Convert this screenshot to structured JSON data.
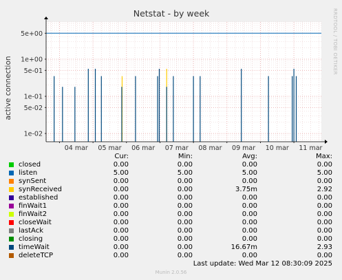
{
  "chart_data": {
    "type": "line",
    "title": "Netstat - by week",
    "ylabel": "active connection",
    "yscale": "log",
    "ylim": [
      0.006,
      10
    ],
    "yticks": [
      0.01,
      0.05,
      0.1,
      0.5,
      1,
      5
    ],
    "ytick_labels": [
      "1e-02",
      "5e-02",
      "1e-01",
      "5e-01",
      "1e+00",
      "5e+00"
    ],
    "xticks": [
      "04 mar",
      "05 mar",
      "06 mar",
      "07 mar",
      "08 mar",
      "09 mar",
      "10 mar",
      "11 mar"
    ],
    "xlim_days": [
      3.6,
      11.82
    ],
    "grid": true,
    "watermark": "RRDTOOL / TOBI OETIKER",
    "series": [
      {
        "name": "closed",
        "color": "#00cc00",
        "values": []
      },
      {
        "name": "listen",
        "color": "#0066b3",
        "constant": 5.0,
        "values": []
      },
      {
        "name": "synSent",
        "color": "#ff8000",
        "values": []
      },
      {
        "name": "synReceived",
        "color": "#ffcc00",
        "spikes": [
          [
            5.87,
            0.35
          ],
          [
            7.2,
            0.55
          ]
        ]
      },
      {
        "name": "established",
        "color": "#330099",
        "values": []
      },
      {
        "name": "finWait1",
        "color": "#990099",
        "values": []
      },
      {
        "name": "finWait2",
        "color": "#ccff00",
        "values": []
      },
      {
        "name": "closeWait",
        "color": "#ff0000",
        "values": []
      },
      {
        "name": "lastAck",
        "color": "#808080",
        "values": []
      },
      {
        "name": "closing",
        "color": "#008f00",
        "values": []
      },
      {
        "name": "timeWait",
        "color": "#00487d",
        "spikes": [
          [
            3.84,
            0.35
          ],
          [
            4.09,
            0.18
          ],
          [
            4.46,
            0.18
          ],
          [
            4.86,
            0.55
          ],
          [
            5.07,
            0.55
          ],
          [
            5.25,
            0.35
          ],
          [
            5.86,
            0.18
          ],
          [
            6.27,
            0.35
          ],
          [
            6.93,
            0.35
          ],
          [
            6.98,
            0.55
          ],
          [
            7.2,
            0.18
          ],
          [
            7.4,
            0.35
          ],
          [
            8.0,
            0.35
          ],
          [
            8.2,
            0.35
          ],
          [
            9.43,
            0.55
          ],
          [
            10.24,
            0.35
          ],
          [
            10.95,
            0.35
          ],
          [
            11.0,
            0.55
          ],
          [
            11.07,
            0.35
          ]
        ]
      },
      {
        "name": "deleteTCP",
        "color": "#b35a00",
        "values": []
      }
    ]
  },
  "legend": {
    "headers": [
      "Cur:",
      "Min:",
      "Avg:",
      "Max:"
    ],
    "rows": [
      {
        "name": "closed",
        "color": "#00cc00",
        "cur": "0.00",
        "min": "0.00",
        "avg": "0.00",
        "max": "0.00"
      },
      {
        "name": "listen",
        "color": "#0066b3",
        "cur": "5.00",
        "min": "5.00",
        "avg": "5.00",
        "max": "5.00"
      },
      {
        "name": "synSent",
        "color": "#ff8000",
        "cur": "0.00",
        "min": "0.00",
        "avg": "0.00",
        "max": "0.00"
      },
      {
        "name": "synReceived",
        "color": "#ffcc00",
        "cur": "0.00",
        "min": "0.00",
        "avg": "3.75m",
        "max": "2.92"
      },
      {
        "name": "established",
        "color": "#330099",
        "cur": "0.00",
        "min": "0.00",
        "avg": "0.00",
        "max": "0.00"
      },
      {
        "name": "finWait1",
        "color": "#990099",
        "cur": "0.00",
        "min": "0.00",
        "avg": "0.00",
        "max": "0.00"
      },
      {
        "name": "finWait2",
        "color": "#ccff00",
        "cur": "0.00",
        "min": "0.00",
        "avg": "0.00",
        "max": "0.00"
      },
      {
        "name": "closeWait",
        "color": "#ff0000",
        "cur": "0.00",
        "min": "0.00",
        "avg": "0.00",
        "max": "0.00"
      },
      {
        "name": "lastAck",
        "color": "#808080",
        "cur": "0.00",
        "min": "0.00",
        "avg": "0.00",
        "max": "0.00"
      },
      {
        "name": "closing",
        "color": "#008f00",
        "cur": "0.00",
        "min": "0.00",
        "avg": "0.00",
        "max": "0.00"
      },
      {
        "name": "timeWait",
        "color": "#00487d",
        "cur": "0.00",
        "min": "0.00",
        "avg": "16.67m",
        "max": "2.93"
      },
      {
        "name": "deleteTCP",
        "color": "#b35a00",
        "cur": "0.00",
        "min": "0.00",
        "avg": "0.00",
        "max": "0.00"
      }
    ]
  },
  "footer": {
    "last_update": "Last update: Wed Mar 12 08:30:09 2025",
    "munin": "Munin 2.0.56"
  }
}
